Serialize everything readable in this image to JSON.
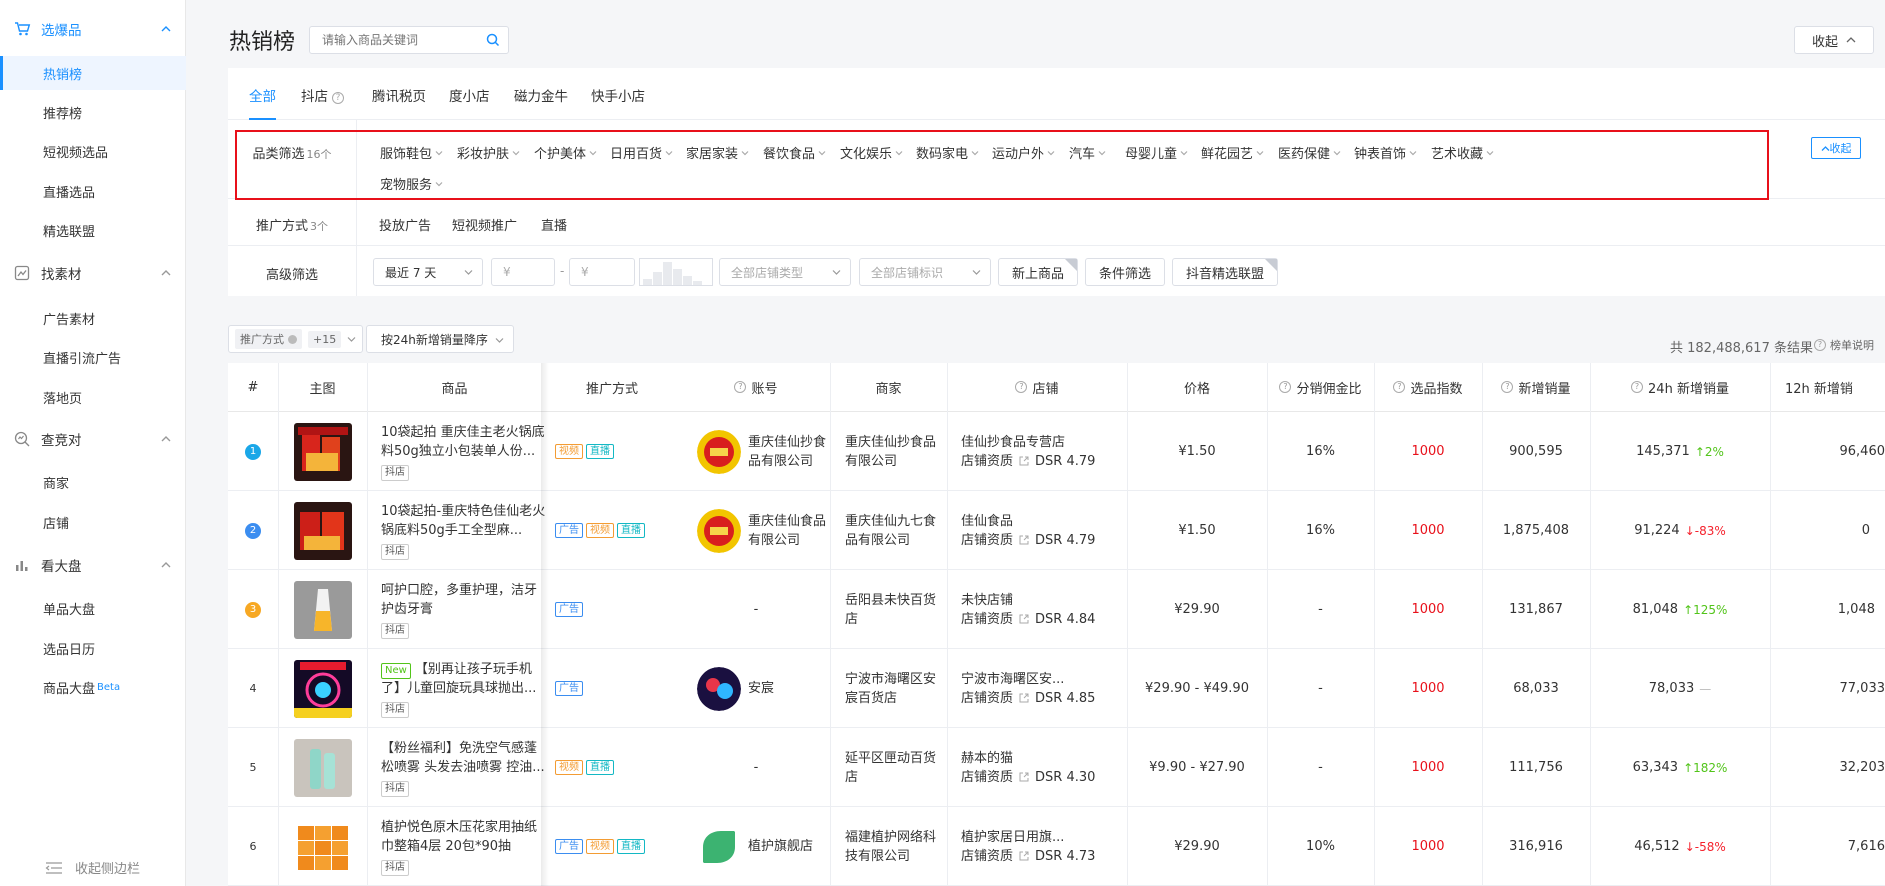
{
  "sidebar": {
    "groups": [
      {
        "label": "选爆品",
        "items": [
          "热销榜",
          "推荐榜",
          "短视频选品",
          "直播选品",
          "精选联盟"
        ]
      },
      {
        "label": "找素材",
        "items": [
          "广告素材",
          "直播引流广告",
          "落地页"
        ]
      },
      {
        "label": "查竞对",
        "items": [
          "商家",
          "店铺"
        ]
      },
      {
        "label": "看大盘",
        "items": [
          "单品大盘",
          "选品日历",
          "商品大盘"
        ]
      }
    ],
    "beta": "Beta",
    "collapse_label": "收起侧边栏"
  },
  "header": {
    "title": "热销榜",
    "search_placeholder": "请输入商品关键词",
    "collapse_label": "收起"
  },
  "tabs": [
    "全部",
    "抖店",
    "腾讯税页",
    "度小店",
    "磁力金牛",
    "快手小店"
  ],
  "filters": {
    "category_label": "品类筛选",
    "category_count": "16个",
    "categories": [
      "服饰鞋包",
      "彩妆护肤",
      "个护美体",
      "日用百货",
      "家居家装",
      "餐饮食品",
      "文化娱乐",
      "数码家电",
      "运动户外",
      "汽车",
      "母婴儿童",
      "鲜花园艺",
      "医药保健",
      "钟表首饰",
      "艺术收藏",
      "宠物服务"
    ],
    "fold_label": "收起",
    "promo_label": "推广方式",
    "promo_count": "3个",
    "promo_items": [
      "投放广告",
      "短视频推广",
      "直播"
    ],
    "advanced_label": "高级筛选",
    "date_range": "最近 7 天",
    "price_min_placeholder": "¥",
    "price_max_placeholder": "¥",
    "range_dash": "-",
    "store_type_placeholder": "全部店铺类型",
    "store_tag_placeholder": "全部店铺标识",
    "new_product": "新上商品",
    "condition": "条件筛选",
    "alliance": "抖音精选联盟"
  },
  "toolbar": {
    "promo_chip": "推广方式",
    "promo_more": "+15",
    "sort_label": "按24h新增销量降序",
    "total": "共 182,488,617 条结果",
    "explain": "榜单说明"
  },
  "table": {
    "headers": [
      "#",
      "主图",
      "商品",
      "推广方式",
      "账号",
      "商家",
      "店铺",
      "价格",
      "分销佣金比",
      "选品指数",
      "新增销量",
      "24h 新增销量",
      "12h 新增销"
    ],
    "src_label": "抖店",
    "shop_qual_label": "店铺资质",
    "new_label": "New",
    "tag_labels": {
      "video": "视频",
      "live": "直播",
      "ad": "广告"
    },
    "rows": [
      {
        "rank": "1",
        "title": "10袋起拍 重庆佳主老火锅底料50g独立小包装单人份...",
        "tags": [
          "video",
          "live"
        ],
        "account": "重庆佳仙抄食品有限公司",
        "merchant": "重庆佳仙抄食品有限公司",
        "shop": "佳仙抄食品专营店",
        "dsr": "DSR 4.79",
        "price": "¥1.50",
        "commission": "16%",
        "index": "1000",
        "sales": "900,595",
        "sales24": "145,371",
        "trend": "2%",
        "trend_dir": "up",
        "sales12": "96,460"
      },
      {
        "rank": "2",
        "title": "10袋起拍-重庆特色佳仙老火锅底料50g手工全型麻...",
        "tags": [
          "ad",
          "video",
          "live"
        ],
        "account": "重庆佳仙食品有限公司",
        "merchant": "重庆佳仙九七食品有限公司",
        "shop": "佳仙食品",
        "dsr": "DSR 4.79",
        "price": "¥1.50",
        "commission": "16%",
        "index": "1000",
        "sales": "1,875,408",
        "sales24": "91,224",
        "trend": "-83%",
        "trend_dir": "down",
        "sales12": "0"
      },
      {
        "rank": "3",
        "title": "呵护口腔，多重护理，洁牙护齿牙膏",
        "tags": [
          "ad"
        ],
        "account": "-",
        "merchant": "岳阳县未快百货店",
        "shop": "未快店铺",
        "dsr": "DSR 4.84",
        "price": "¥29.90",
        "commission": "-",
        "index": "1000",
        "sales": "131,867",
        "sales24": "81,048",
        "trend": "125%",
        "trend_dir": "up",
        "sales12": "1,048"
      },
      {
        "rank": "4",
        "title": "【别再让孩子玩手机了】儿童回旋玩具球抛出...",
        "tags": [
          "ad"
        ],
        "account": "安宸",
        "merchant": "宁波市海曙区安宸百货店",
        "shop": "宁波市海曙区安...",
        "dsr": "DSR 4.85",
        "price": "¥29.90 - ¥49.90",
        "commission": "-",
        "index": "1000",
        "sales": "68,033",
        "sales24": "78,033",
        "trend": "—",
        "trend_dir": "neutral",
        "sales12": "77,033",
        "is_new": true
      },
      {
        "rank": "5",
        "title": "【粉丝福利】免洗空气感蓬松喷雾 头发去油喷雾 控油...",
        "tags": [
          "video",
          "live"
        ],
        "account": "-",
        "merchant": "延平区匣动百货店",
        "shop": "赫本的猫",
        "dsr": "DSR 4.30",
        "price": "¥9.90 - ¥27.90",
        "commission": "-",
        "index": "1000",
        "sales": "111,756",
        "sales24": "63,343",
        "trend": "182%",
        "trend_dir": "up",
        "sales12": "32,203"
      },
      {
        "rank": "6",
        "title": "植护悦色原木压花家用抽纸巾整箱4层 20包*90抽",
        "tags": [
          "ad",
          "video",
          "live"
        ],
        "account": "植护旗舰店",
        "merchant": "福建植护网络科技有限公司",
        "shop": "植护家居日用旗...",
        "dsr": "DSR 4.73",
        "price": "¥29.90",
        "commission": "10%",
        "index": "1000",
        "sales": "316,916",
        "sales24": "46,512",
        "trend": "-58%",
        "trend_dir": "down",
        "sales12": "7,616"
      }
    ]
  },
  "colors": {
    "accent": "#1a90ff",
    "rank1": "#1aa7e8",
    "rank2": "#3b8df0",
    "rank3": "#f7a823",
    "highlight": "#e8101a"
  }
}
